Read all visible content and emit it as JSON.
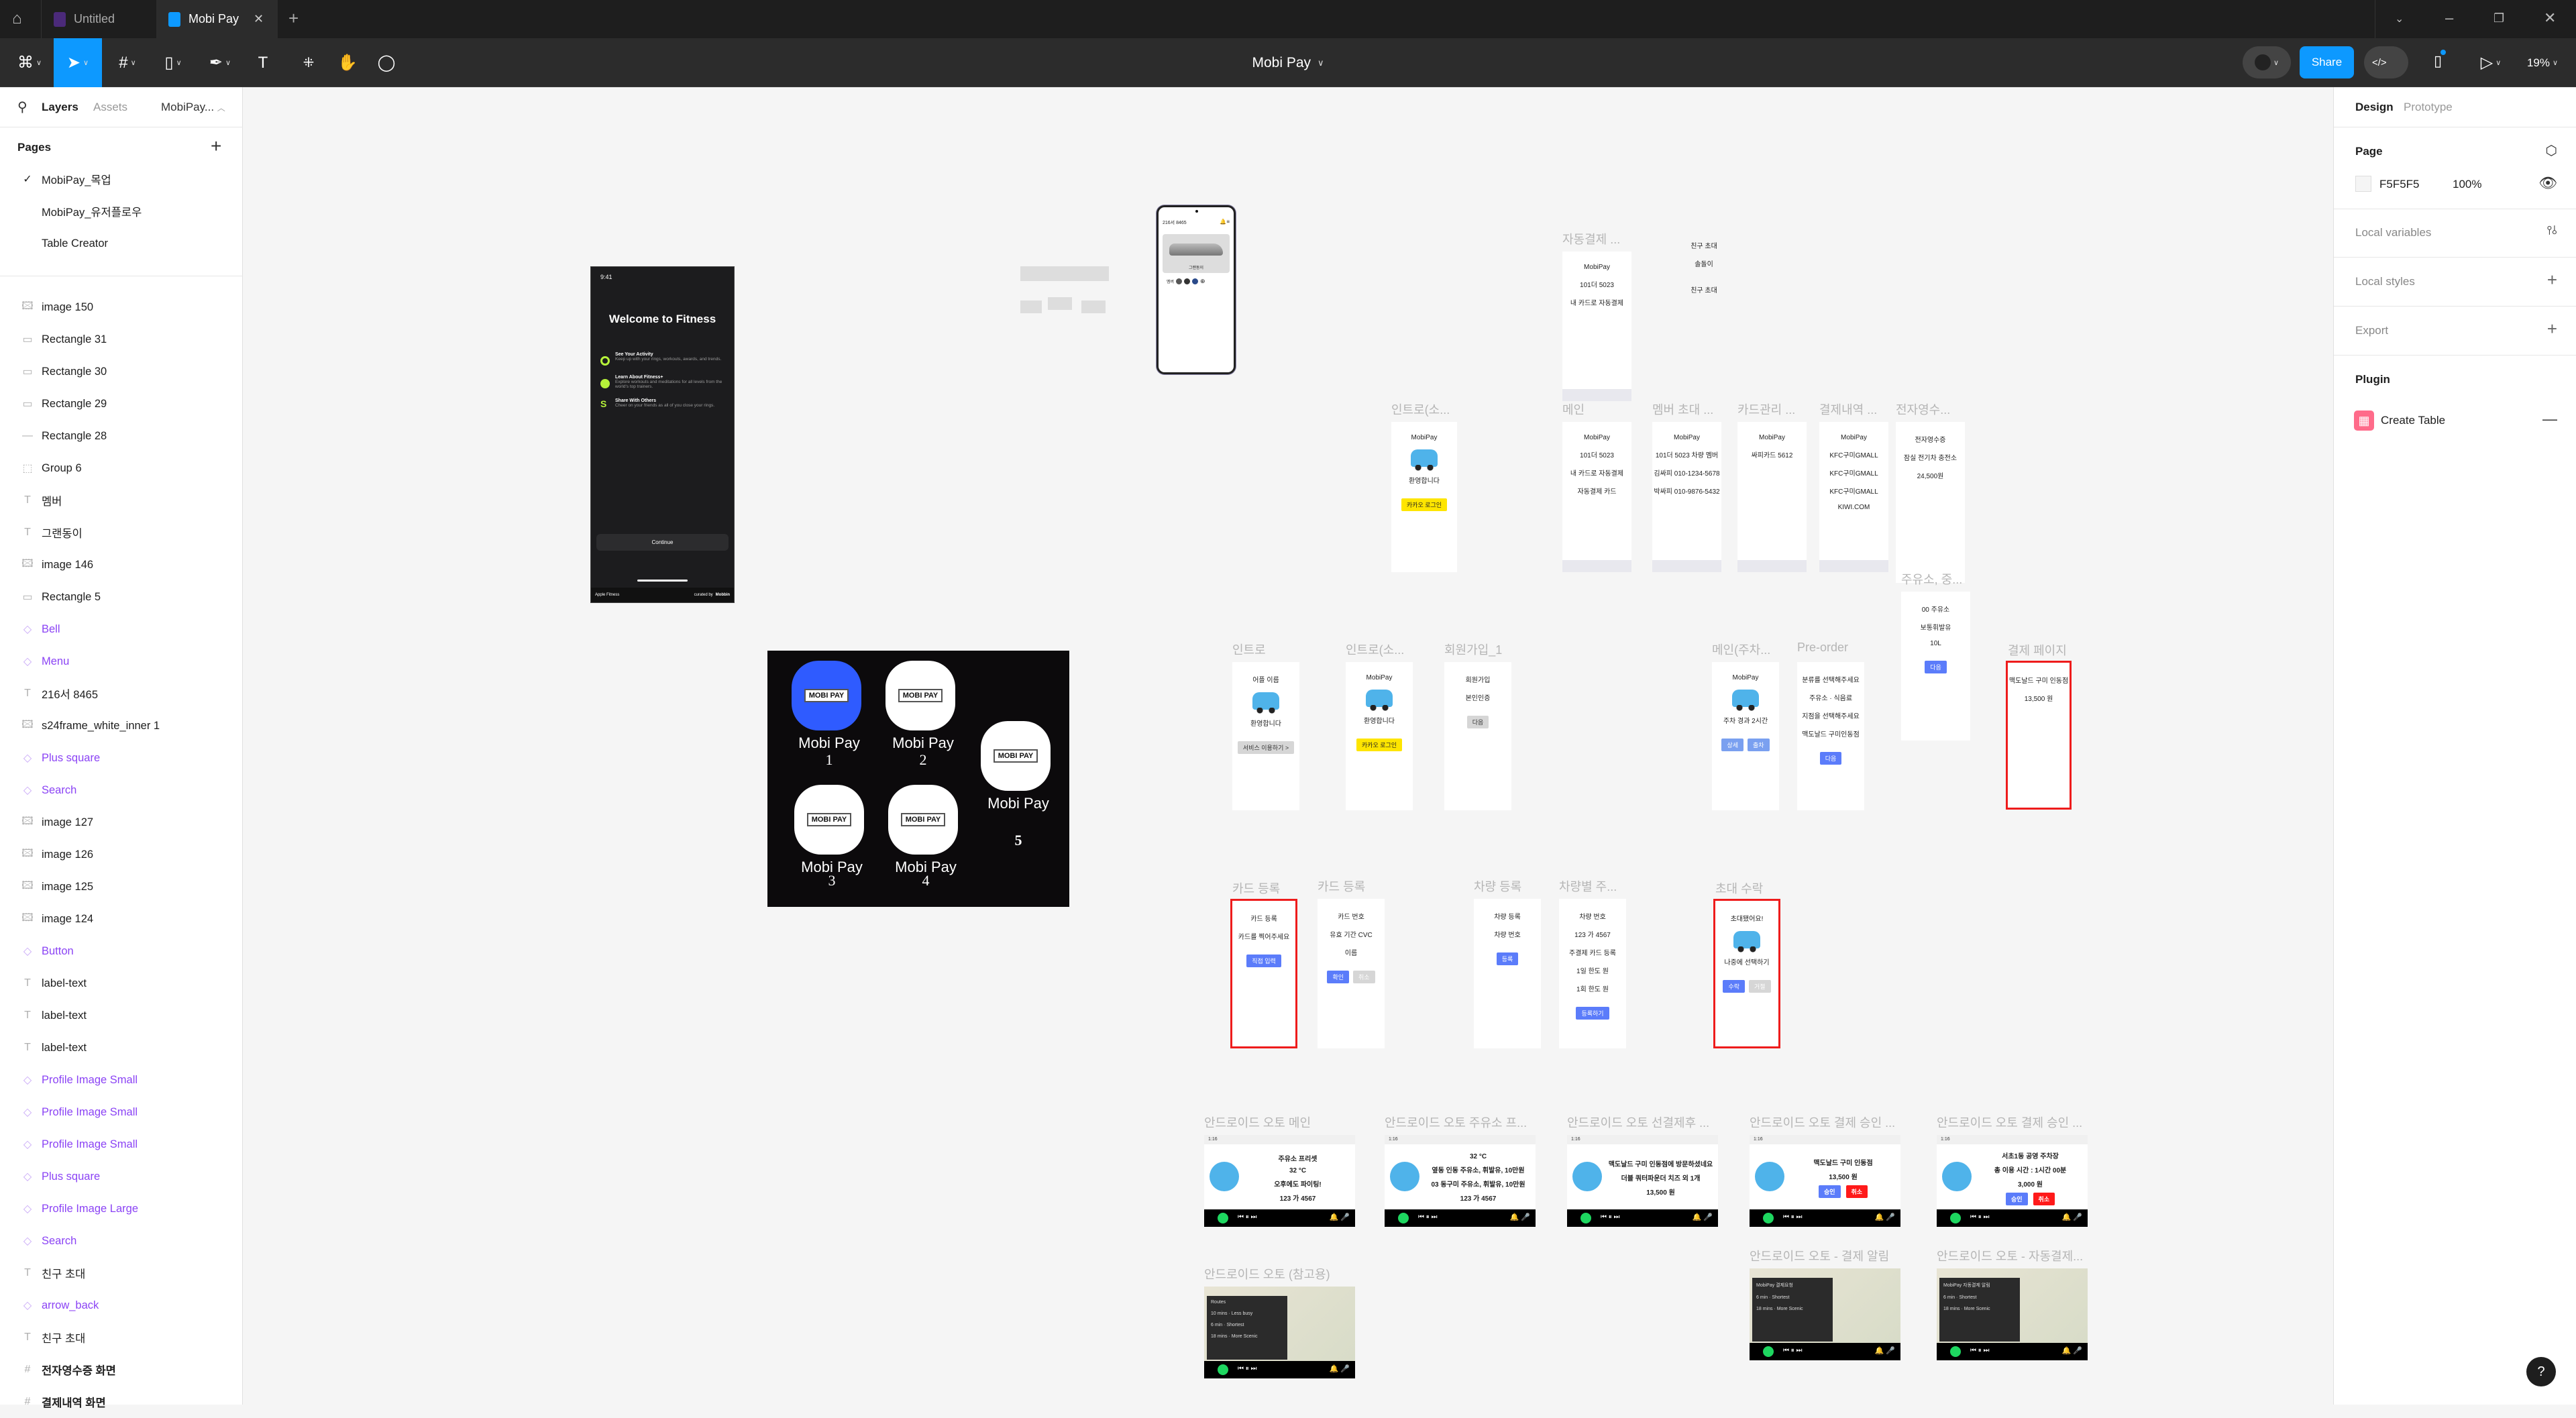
{
  "tabs": [
    {
      "label": "Untitled",
      "color": "#4b2a7a"
    },
    {
      "label": "Mobi Pay",
      "color": "#0d99ff",
      "active": true
    }
  ],
  "toolbar": {
    "file_title": "Mobi Pay",
    "share_label": "Share",
    "zoom": "19%",
    "code_label": "</>",
    "accent": "#0d99ff"
  },
  "left_panel": {
    "tabs": [
      "Layers",
      "Assets"
    ],
    "file_name": "MobiPay...",
    "pages_title": "Pages",
    "pages": [
      {
        "label": "MobiPay_목업",
        "current": true
      },
      {
        "label": "MobiPay_유저플로우"
      },
      {
        "label": "Table Creator"
      }
    ],
    "layers": [
      {
        "label": "image 150",
        "type": "image"
      },
      {
        "label": "Rectangle 31",
        "type": "rect"
      },
      {
        "label": "Rectangle 30",
        "type": "rect"
      },
      {
        "label": "Rectangle 29",
        "type": "rect"
      },
      {
        "label": "Rectangle 28",
        "type": "line"
      },
      {
        "label": "Group 6",
        "type": "group"
      },
      {
        "label": "멤버",
        "type": "text"
      },
      {
        "label": "그랜동이",
        "type": "text"
      },
      {
        "label": "image 146",
        "type": "image"
      },
      {
        "label": "Rectangle 5",
        "type": "rect"
      },
      {
        "label": "Bell",
        "type": "component"
      },
      {
        "label": "Menu",
        "type": "component"
      },
      {
        "label": "216서 8465",
        "type": "text"
      },
      {
        "label": "s24frame_white_inner 1",
        "type": "image"
      },
      {
        "label": "Plus square",
        "type": "component"
      },
      {
        "label": "Search",
        "type": "component"
      },
      {
        "label": "image 127",
        "type": "image"
      },
      {
        "label": "image 126",
        "type": "image"
      },
      {
        "label": "image 125",
        "type": "image"
      },
      {
        "label": "image 124",
        "type": "image"
      },
      {
        "label": "Button",
        "type": "component"
      },
      {
        "label": "label-text",
        "type": "text"
      },
      {
        "label": "label-text",
        "type": "text"
      },
      {
        "label": "label-text",
        "type": "text"
      },
      {
        "label": "Profile Image Small",
        "type": "component"
      },
      {
        "label": "Profile Image Small",
        "type": "component"
      },
      {
        "label": "Profile Image Small",
        "type": "component"
      },
      {
        "label": "Plus square",
        "type": "component"
      },
      {
        "label": "Profile Image Large",
        "type": "component"
      },
      {
        "label": "Search",
        "type": "component"
      },
      {
        "label": "친구 초대",
        "type": "text"
      },
      {
        "label": "arrow_back",
        "type": "component"
      },
      {
        "label": "친구 초대",
        "type": "text"
      },
      {
        "label": "전자영수증 화면",
        "type": "frame"
      },
      {
        "label": "결제내역 화면",
        "type": "frame"
      }
    ]
  },
  "right_panel": {
    "tabs": [
      "Design",
      "Prototype"
    ],
    "page_title": "Page",
    "page_color": "F5F5F5",
    "page_opacity": "100%",
    "local_variables": "Local variables",
    "local_styles": "Local styles",
    "export": "Export",
    "plugin_title": "Plugin",
    "plugin_name": "Create Table",
    "plugin_color": "#ff6b8a"
  },
  "canvas": {
    "background": "#F5F5F5",
    "fitness": {
      "time": "9:41",
      "title": "Welcome to Fitness",
      "items": [
        {
          "title": "See Your Activity",
          "desc": "Keep up with your rings, workouts, awards, and trends."
        },
        {
          "title": "Learn About Fitness+",
          "desc": "Explore workouts and meditations for all levels from the world's top trainers."
        },
        {
          "title": "Share With Others",
          "desc": "Cheer on your friends as all of you close your rings."
        }
      ],
      "continue": "Continue",
      "footer_left": "Apple Fitness",
      "footer_right": "curated by",
      "footer_brand": "Mobbin"
    },
    "phone": {
      "plate": "216서 8465",
      "car_name": "그랜동이",
      "member": "멤버"
    },
    "app_icons": {
      "badge": "MOBI PAY",
      "items": [
        {
          "label": "Mobi Pay",
          "num": "1"
        },
        {
          "label": "Mobi Pay",
          "num": "2"
        },
        {
          "label": "Mobi Pay",
          "num": "3"
        },
        {
          "label": "Mobi Pay",
          "num": "4"
        },
        {
          "label": "Mobi Pay",
          "num": "5"
        }
      ]
    },
    "frames": [
      {
        "label": "자동결제 ...",
        "lines": [
          "MobiPay",
          "101더 5023",
          "내 카드로 자동결제"
        ],
        "tabbar": true
      },
      {
        "label": "",
        "lines": [
          "친구 초대",
          "솔돌이",
          "",
          "친구 초대"
        ],
        "transparent": true
      },
      {
        "label": "인트로(소...",
        "lines": [
          "MobiPay",
          "환영합니다"
        ],
        "car": true,
        "buttons": [
          {
            "label": "카카오 로그인",
            "color": "#fee500",
            "text": "#222"
          }
        ]
      },
      {
        "label": "메인",
        "lines": [
          "MobiPay",
          "101더 5023",
          "내 카드로 자동결제",
          "자동결제 카드"
        ],
        "tabbar": true
      },
      {
        "label": "멤버 초대 ...",
        "lines": [
          "MobiPay",
          "101더 5023 차량 멤버",
          "김싸피 010-1234-5678",
          "박싸피 010-9876-5432"
        ],
        "tabbar": true
      },
      {
        "label": "카드관리 ...",
        "lines": [
          "MobiPay",
          "싸피카드 5612"
        ],
        "tabbar": true
      },
      {
        "label": "결제내역 ...",
        "lines": [
          "MobiPay",
          "KFC구미GMALL",
          "KFC구미GMALL",
          "KFC구미GMALL",
          "KIWI.COM"
        ],
        "tabbar": true
      },
      {
        "label": "전자영수...",
        "lines": [
          "전자영수증",
          "잠실 전기차 충전소",
          "24,500원"
        ]
      },
      {
        "label": "주유소, 중...",
        "lines": [
          "00 주유소",
          "보통휘발유",
          "10L"
        ],
        "buttons": [
          {
            "label": "다음",
            "color": "#5b7cfa"
          }
        ]
      },
      {
        "label": "인트로",
        "lines": [
          "어플 이름",
          "환영합니다"
        ],
        "car": true,
        "buttons": [
          {
            "label": "서비스 이용하기 >",
            "color": "#d6d6d6",
            "text": "#333"
          }
        ]
      },
      {
        "label": "인트로(소...",
        "lines": [
          "MobiPay",
          "환영합니다"
        ],
        "car": true,
        "buttons": [
          {
            "label": "카카오 로그인",
            "color": "#fee500",
            "text": "#222"
          }
        ]
      },
      {
        "label": "회원가입_1",
        "lines": [
          "회원가입",
          "본인인증"
        ],
        "buttons": [
          {
            "label": "다음",
            "color": "#d6d6d6",
            "text": "#333"
          }
        ]
      },
      {
        "label": "메인(주차...",
        "lines": [
          "MobiPay",
          "주차 경과 2시간"
        ],
        "car": true,
        "buttons": [
          {
            "label": "상세",
            "color": "#7aa0f0"
          },
          {
            "label": "출차",
            "color": "#7aa0f0"
          }
        ]
      },
      {
        "label": "Pre-order",
        "lines": [
          "분류를 선택해주세요",
          "주유소 · 식음료",
          "지점을 선택해주세요",
          "맥도날드 구미인동점"
        ],
        "buttons": [
          {
            "label": "다음",
            "color": "#5b7cfa"
          }
        ]
      },
      {
        "label": "결제 페이지",
        "lines": [
          "맥도날드 구미 인동점",
          "13,500 원"
        ],
        "red": true
      },
      {
        "label": "카드 등록",
        "lines": [
          "카드 등록",
          "카드를 찍어주세요"
        ],
        "red": true,
        "buttons": [
          {
            "label": "직접 입력",
            "color": "#5b7cfa"
          }
        ]
      },
      {
        "label": "카드 등록",
        "lines": [
          "카드 번호",
          "유효 기간   CVC",
          "이름"
        ],
        "buttons": [
          {
            "label": "확인",
            "color": "#5b7cfa"
          },
          {
            "label": "취소",
            "color": "#d6d6d6"
          }
        ]
      },
      {
        "label": "차량 등록",
        "lines": [
          "차량 등록",
          "차량 번호"
        ],
        "buttons": [
          {
            "label": "등록",
            "color": "#5b7cfa"
          }
        ]
      },
      {
        "label": "차량별 주...",
        "lines": [
          "차량 번호",
          "123 가 4567",
          "주결제 카드 등록",
          "1일 한도 원",
          "1회 한도 원"
        ],
        "buttons": [
          {
            "label": "등록하기",
            "color": "#5b7cfa"
          }
        ]
      },
      {
        "label": "초대 수락",
        "lines": [
          "초대됐어요!",
          "나중에 선택하기"
        ],
        "car": true,
        "red": true,
        "buttons": [
          {
            "label": "수락",
            "color": "#5b7cfa"
          },
          {
            "label": "거절",
            "color": "#d6d6d6"
          }
        ]
      },
      {
        "label": "안드로이드 오토 메인",
        "auto": true,
        "lines": [
          "주유소 프리셋",
          "32 °C",
          "오후에도 파이팅!",
          "123 가 4567"
        ]
      },
      {
        "label": "안드로이드 오토 주유소 프...",
        "auto": true,
        "lines": [
          "32 °C",
          "옆동 인동 주유소, 휘발유, 10만원",
          "03 동구미 주유소, 휘발유, 10만원",
          "123 가 4567"
        ]
      },
      {
        "label": "안드로이드 오토 선결제후 ...",
        "auto": true,
        "lines": [
          "맥도날드 구미 인동점에 방문하셨네요",
          "더블 쿼터파운더 치즈 외 1개",
          "13,500 원"
        ]
      },
      {
        "label": "안드로이드 오토 결제 승인 ...",
        "auto": true,
        "lines": [
          "맥도날드 구미 인동점",
          "13,500 원"
        ],
        "buttons": [
          {
            "label": "승인",
            "color": "#5b7cfa"
          },
          {
            "label": "취소",
            "color": "#ff1a1a"
          }
        ]
      },
      {
        "label": "안드로이드 오토 결제 승인 ...",
        "auto": true,
        "lines": [
          "서초1동 공영 주차장",
          "총 이용 시간 : 1시간 00분",
          "3,000 원"
        ],
        "buttons": [
          {
            "label": "승인",
            "color": "#5b7cfa"
          },
          {
            "label": "취소",
            "color": "#ff1a1a"
          }
        ]
      },
      {
        "label": "안드로이드 오토 (참고용)",
        "auto": true,
        "map": true,
        "lines": [
          "Routes",
          "10 mins · Less busy",
          "6 min · Shortest",
          "18 mins · More Scenic"
        ]
      },
      {
        "label": "안드로이드 오토 - 결제 알림",
        "auto": true,
        "map": true,
        "lines": [
          "MobiPay 결제요청",
          "6 min · Shortest",
          "18 mins · More Scenic"
        ]
      },
      {
        "label": "안드로이드 오토 - 자동결제...",
        "auto": true,
        "map": true,
        "lines": [
          "MobiPay 자동결제 알림",
          "6 min · Shortest",
          "18 mins · More Scenic"
        ]
      }
    ],
    "auto_time": "1:16",
    "help": "?"
  }
}
